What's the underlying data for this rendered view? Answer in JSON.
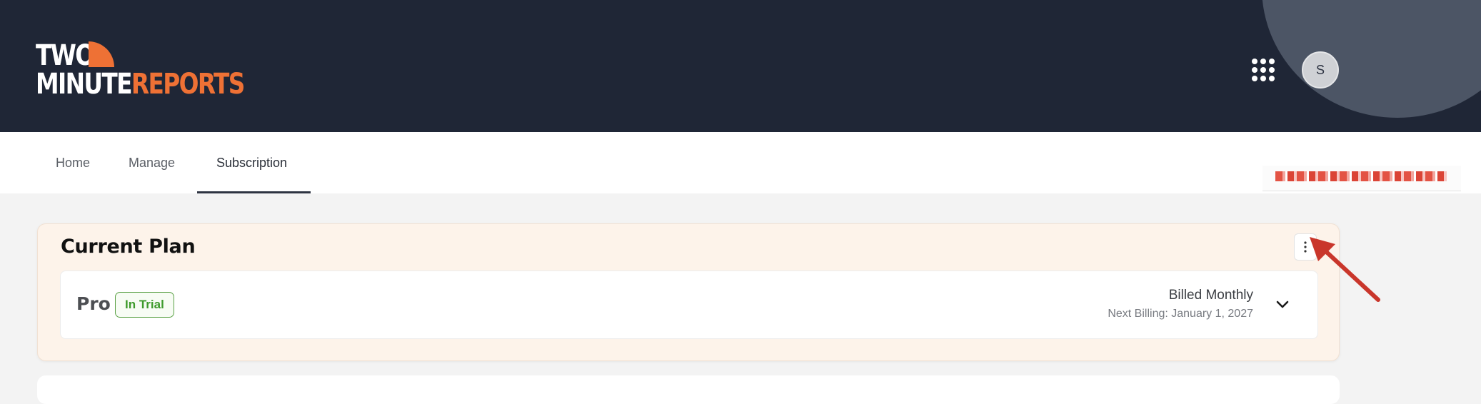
{
  "header": {
    "logo": {
      "line1": "TWO",
      "line2_white": "MINUTE",
      "line2_orange": "REPORTS"
    },
    "apps_icon": "apps-grid-icon",
    "avatar_initial": "S"
  },
  "tabs": [
    {
      "label": "Home"
    },
    {
      "label": "Manage"
    },
    {
      "label": "Subscription"
    }
  ],
  "active_tab": "Subscription",
  "current_plan": {
    "title": "Current Plan",
    "menu_icon": "kebab-menu-icon",
    "plan": {
      "name": "Pro",
      "status_badge": "In Trial",
      "billing_cycle": "Billed Monthly",
      "next_billing": "Next Billing: January 1, 2027",
      "expand_icon": "chevron-down-icon"
    }
  },
  "colors": {
    "header_bg": "#1f2636",
    "accent_orange": "#ee7135",
    "badge_green": "#3d9a2b",
    "card_bg": "#fdf3ea",
    "annotation_red": "#c9362b"
  }
}
